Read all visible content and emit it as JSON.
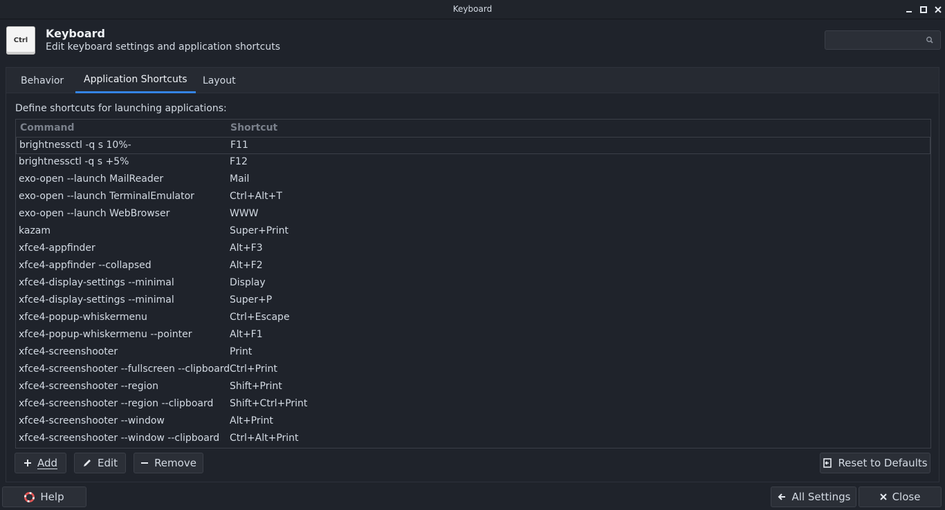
{
  "window": {
    "title": "Keyboard"
  },
  "header": {
    "icon_text": "Ctrl",
    "title": "Keyboard",
    "subtitle": "Edit keyboard settings and application shortcuts",
    "search": {
      "value": "",
      "placeholder": ""
    }
  },
  "tabs": [
    {
      "label": "Behavior",
      "active": false
    },
    {
      "label": "Application Shortcuts",
      "active": true
    },
    {
      "label": "Layout",
      "active": false
    }
  ],
  "content": {
    "description": "Define shortcuts for launching applications:",
    "columns": {
      "command": "Command",
      "shortcut": "Shortcut"
    },
    "rows": [
      {
        "command": "brightnessctl -q s 10%-",
        "shortcut": "F11"
      },
      {
        "command": "brightnessctl -q s +5%",
        "shortcut": "F12"
      },
      {
        "command": "exo-open --launch MailReader",
        "shortcut": "Mail"
      },
      {
        "command": "exo-open --launch TerminalEmulator",
        "shortcut": "Ctrl+Alt+T"
      },
      {
        "command": "exo-open --launch WebBrowser",
        "shortcut": "WWW"
      },
      {
        "command": "kazam",
        "shortcut": "Super+Print"
      },
      {
        "command": "xfce4-appfinder",
        "shortcut": "Alt+F3"
      },
      {
        "command": "xfce4-appfinder --collapsed",
        "shortcut": "Alt+F2"
      },
      {
        "command": "xfce4-display-settings --minimal",
        "shortcut": "Display"
      },
      {
        "command": "xfce4-display-settings --minimal",
        "shortcut": "Super+P"
      },
      {
        "command": "xfce4-popup-whiskermenu",
        "shortcut": "Ctrl+Escape"
      },
      {
        "command": "xfce4-popup-whiskermenu --pointer",
        "shortcut": "Alt+F1"
      },
      {
        "command": "xfce4-screenshooter",
        "shortcut": "Print"
      },
      {
        "command": "xfce4-screenshooter --fullscreen --clipboard",
        "shortcut": "Ctrl+Print"
      },
      {
        "command": "xfce4-screenshooter --region",
        "shortcut": "Shift+Print"
      },
      {
        "command": "xfce4-screenshooter --region --clipboard",
        "shortcut": "Shift+Ctrl+Print"
      },
      {
        "command": "xfce4-screenshooter --window",
        "shortcut": "Alt+Print"
      },
      {
        "command": "xfce4-screenshooter --window --clipboard",
        "shortcut": "Ctrl+Alt+Print"
      }
    ],
    "selected_row": 0
  },
  "actions": {
    "add": "Add",
    "edit": "Edit",
    "remove": "Remove",
    "reset": "Reset to Defaults"
  },
  "footer": {
    "help": "Help",
    "all_settings": "All Settings",
    "close": "Close"
  },
  "colors": {
    "background": "#1f232b",
    "accent": "#3584e4",
    "help_icon": "#e05555"
  }
}
